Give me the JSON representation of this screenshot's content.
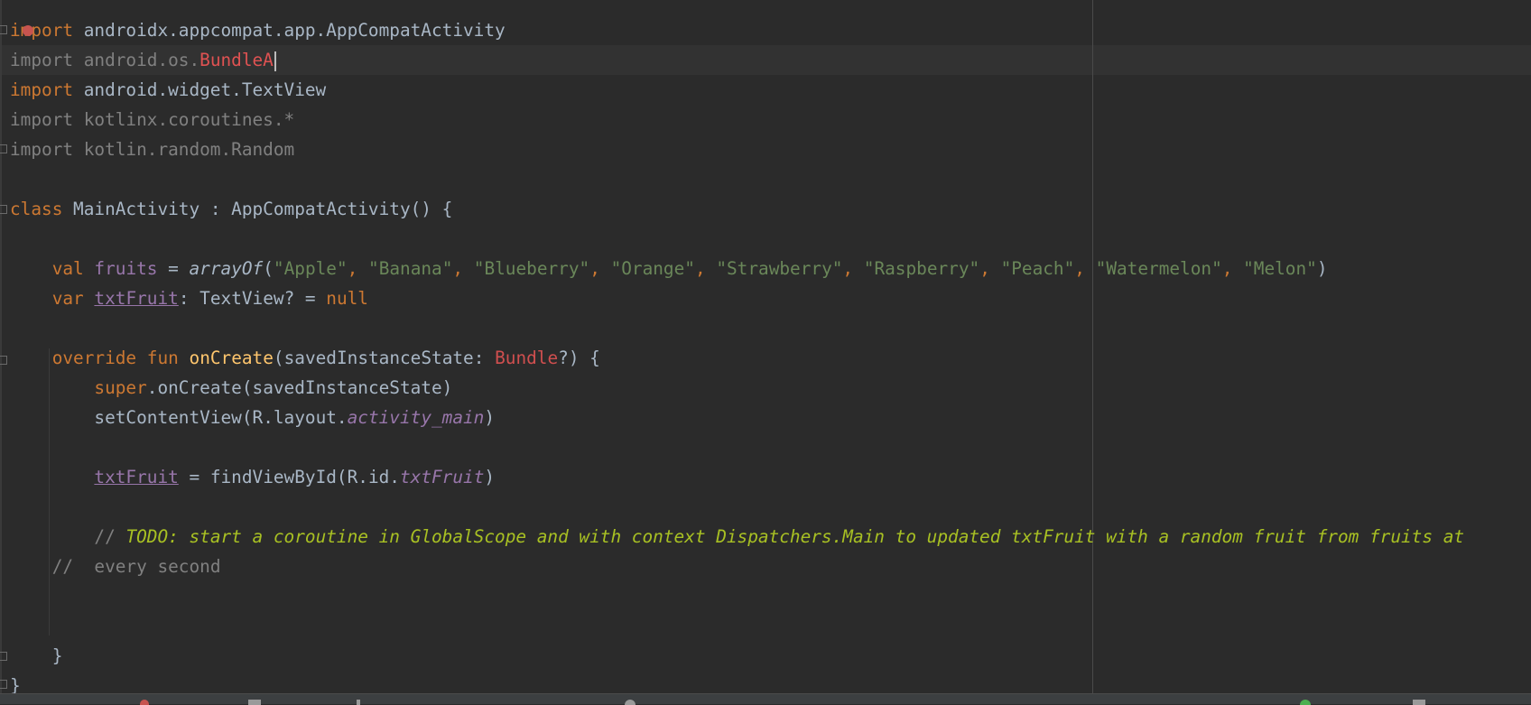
{
  "editor": {
    "language": "kotlin",
    "caret_line": 2,
    "lines": [
      {
        "parts": [
          "import",
          " androidx.appcompat.app.AppCompatActivity"
        ]
      },
      {
        "parts": [
          "import",
          " android.os.",
          "BundleA"
        ]
      },
      {
        "parts": [
          "import",
          " android.widget.TextView"
        ]
      },
      {
        "parts": [
          "import",
          " kotlinx.coroutines.*"
        ]
      },
      {
        "parts": [
          "import",
          " kotlin.random.Random"
        ]
      },
      {
        "parts": []
      },
      {
        "parts": [
          "class",
          " MainActivity : AppCompatActivity() {"
        ]
      },
      {
        "parts": []
      },
      {
        "parts": [
          "    ",
          "val",
          " ",
          "fruits",
          " = ",
          "arrayOf",
          "(",
          "\"Apple\"",
          ", ",
          "\"Banana\"",
          ", ",
          "\"Blueberry\"",
          ", ",
          "\"Orange\"",
          ", ",
          "\"Strawberry\"",
          ", ",
          "\"Raspberry\"",
          ", ",
          "\"Peach\"",
          ", ",
          "\"Watermelon\"",
          ", ",
          "\"Melon\"",
          ")"
        ]
      },
      {
        "parts": [
          "    ",
          "var",
          " ",
          "txtFruit",
          ": TextView? = ",
          "null"
        ]
      },
      {
        "parts": []
      },
      {
        "parts": [
          "    ",
          "override",
          " ",
          "fun",
          " ",
          "onCreate",
          "(savedInstanceState: ",
          "Bundle",
          "?) {"
        ]
      },
      {
        "parts": [
          "        ",
          "super",
          ".onCreate(savedInstanceState)"
        ]
      },
      {
        "parts": [
          "        ",
          "setContentView(R.layout.",
          "activity_main",
          ")"
        ]
      },
      {
        "parts": []
      },
      {
        "parts": [
          "        ",
          "txtFruit",
          " = findViewById(R.id.",
          "txtFruit",
          ")"
        ]
      },
      {
        "parts": []
      },
      {
        "parts": [
          "        ",
          "// ",
          "TODO: start a coroutine in GlobalScope and with context Dispatchers.Main to updated txtFruit with a random fruit from fruits at"
        ]
      },
      {
        "parts": [
          "    ",
          "//  every second"
        ]
      },
      {
        "parts": []
      },
      {
        "parts": []
      },
      {
        "parts": [
          "    ",
          "}"
        ]
      },
      {
        "parts": [
          "}"
        ]
      }
    ]
  },
  "colors": {
    "background": "#2b2b2b",
    "keyword": "#cc7832",
    "string": "#6a8759",
    "property": "#9876aa",
    "function_decl": "#ffc66d",
    "todo": "#a8c023",
    "comment": "#808080",
    "error": "#e05252",
    "default_text": "#a9b7c6"
  },
  "icons": [
    "breakpoint-icon",
    "fold-marker-icon",
    "text-caret"
  ]
}
